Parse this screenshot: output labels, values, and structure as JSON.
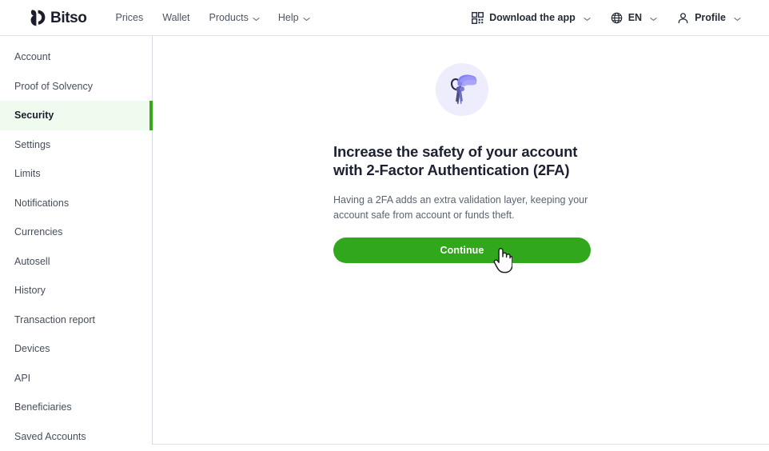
{
  "header": {
    "brand": "Bitso",
    "brand_icon": "bitso-logo-icon",
    "nav": [
      {
        "label": "Prices",
        "caret": false
      },
      {
        "label": "Wallet",
        "caret": false
      },
      {
        "label": "Products",
        "caret": true
      },
      {
        "label": "Help",
        "caret": true
      }
    ],
    "right": [
      {
        "label": "Download the app",
        "icon": "qr-code-icon",
        "caret": true
      },
      {
        "label": "EN",
        "icon": "globe-icon",
        "caret": true
      },
      {
        "label": "Profile",
        "icon": "user-icon",
        "caret": true
      }
    ]
  },
  "sidebar": {
    "items": [
      {
        "label": "Account",
        "active": false
      },
      {
        "label": "Proof of Solvency",
        "active": false
      },
      {
        "label": "Security",
        "active": true
      },
      {
        "label": "Settings",
        "active": false
      },
      {
        "label": "Limits",
        "active": false
      },
      {
        "label": "Notifications",
        "active": false
      },
      {
        "label": "Currencies",
        "active": false
      },
      {
        "label": "Autosell",
        "active": false
      },
      {
        "label": "History",
        "active": false
      },
      {
        "label": "Transaction report",
        "active": false
      },
      {
        "label": "Devices",
        "active": false
      },
      {
        "label": "API",
        "active": false
      },
      {
        "label": "Beneficiaries",
        "active": false
      },
      {
        "label": "Saved Accounts",
        "active": false
      }
    ]
  },
  "main": {
    "illustration": "hand-holding-keys-icon",
    "headline": "Increase the safety of your account with 2-Factor Authentication (2FA)",
    "body": "Having a 2FA adds an extra validation layer, keeping your account safe from account or funds theft.",
    "cta_label": "Continue"
  },
  "colors": {
    "brand_green": "#31a81c",
    "active_row_bg": "#f0fbf0",
    "illustration_bg": "#eeedfd",
    "illustration_hand": "#8481ee",
    "heading": "#1c2030",
    "body_text": "#5a6372"
  },
  "cursor": {
    "type": "pointer-hand-cursor"
  }
}
